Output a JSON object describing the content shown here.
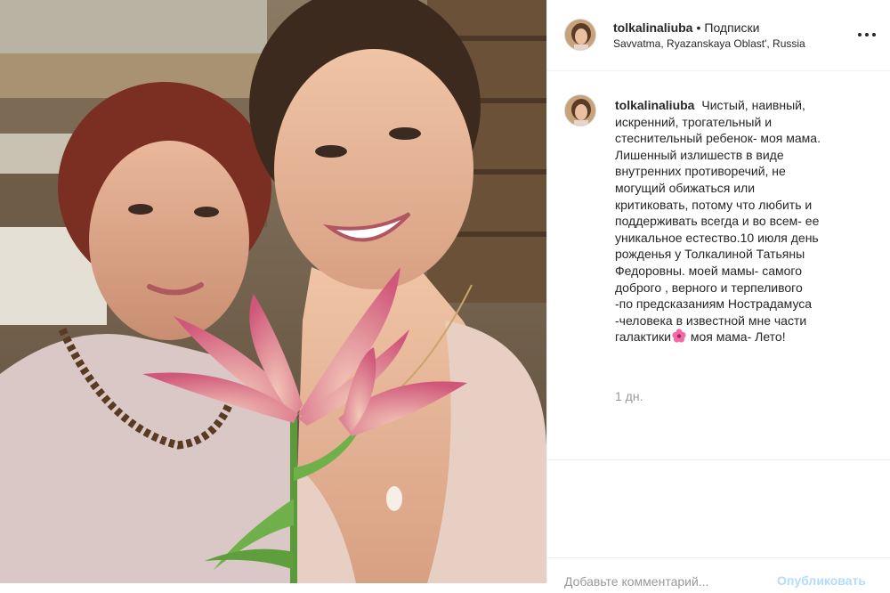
{
  "post": {
    "username": "tolkalinaliuba",
    "separator": "•",
    "follow_label": "Подписки",
    "location": "Savvatma, Ryazanskaya Oblast', Russia",
    "more_icon": "more-options-icon"
  },
  "caption": {
    "username": "tolkalinaliuba",
    "lines": [
      "Чистый, наивный,",
      "искренний, трогательный и",
      "стеснительный ребенок- моя мама.",
      "Лишенный излишеств в виде",
      "внутренних противоречий, не",
      "могущий обижаться или",
      "критиковать, потому что любить и",
      "поддерживать всегда и во всем- ее",
      "уникальное естество.10 июля день",
      "рожденья у Толкалиной Татьяны",
      "Федоровны. моей мамы- самого",
      "доброго , верного и терпеливого",
      "-по предсказаниям Нострадамуса",
      "-человека в известной мне части"
    ],
    "last_line_before_emoji": "галактики",
    "emoji": "hibiscus-emoji",
    "last_line_after_emoji": " моя мама- Лето!",
    "time": "1 дн."
  },
  "comment_box": {
    "placeholder": "Добавьте комментарий...",
    "post_label": "Опубликовать"
  },
  "colors": {
    "text": "#262626",
    "secondary_text": "#999999",
    "divider": "#efefef",
    "post_button_disabled": "#b3dbff"
  }
}
